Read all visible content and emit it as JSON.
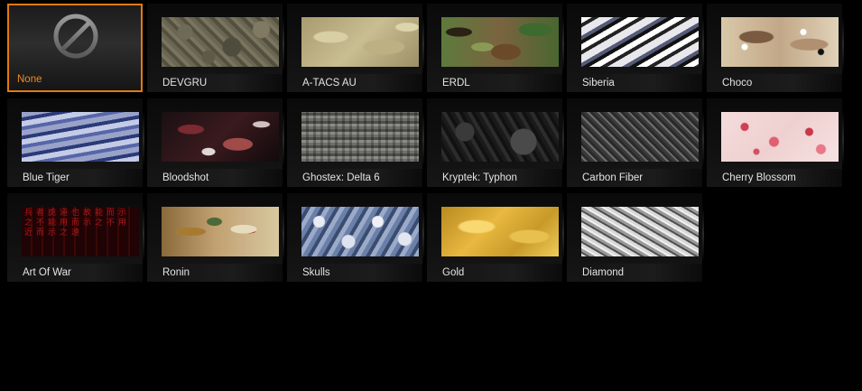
{
  "camos": [
    {
      "label": "None",
      "selected": true,
      "icon": "prohibited-icon"
    },
    {
      "label": "DEVGRU"
    },
    {
      "label": "A-TACS AU"
    },
    {
      "label": "ERDL"
    },
    {
      "label": "Siberia"
    },
    {
      "label": "Choco"
    },
    {
      "label": "Blue Tiger"
    },
    {
      "label": "Bloodshot"
    },
    {
      "label": "Ghostex: Delta 6"
    },
    {
      "label": "Kryptek: Typhon"
    },
    {
      "label": "Carbon Fiber"
    },
    {
      "label": "Cherry Blossom"
    },
    {
      "label": "Art Of War"
    },
    {
      "label": "Ronin"
    },
    {
      "label": "Skulls"
    },
    {
      "label": "Gold"
    },
    {
      "label": "Diamond"
    }
  ],
  "colors": {
    "selected_border": "#e07a14",
    "selected_text": "#f08a20",
    "label_text": "#e4e4e4",
    "background": "#000000"
  }
}
